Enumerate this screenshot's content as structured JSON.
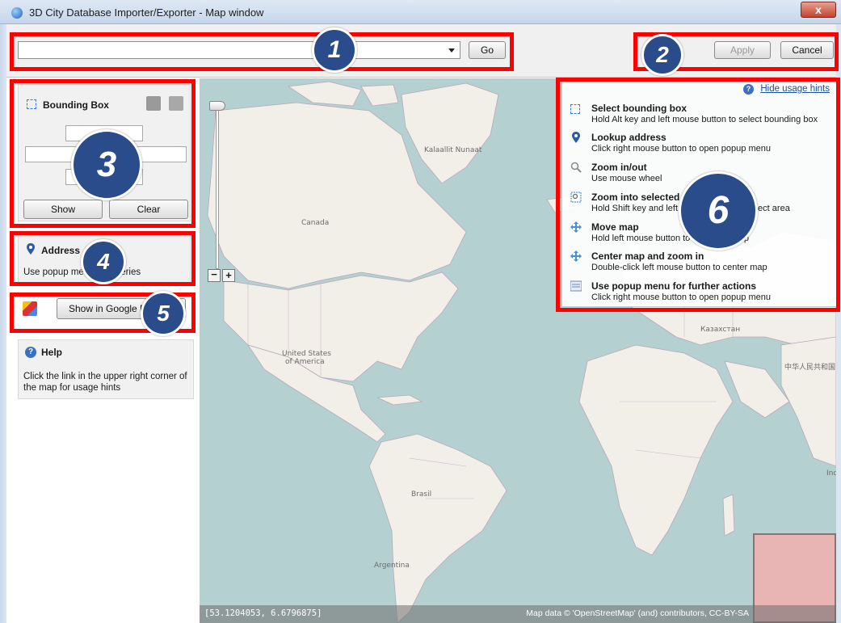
{
  "window": {
    "title": "3D City Database Importer/Exporter - Map window",
    "close_label": "x"
  },
  "toolbar": {
    "search_value": "",
    "go_label": "Go",
    "apply_label": "Apply",
    "cancel_label": "Cancel"
  },
  "left_panel": {
    "bounding_box": {
      "title": "Bounding Box",
      "show_label": "Show",
      "clear_label": "Clear"
    },
    "address": {
      "title": "Address",
      "text": "Use popup menu for queries"
    },
    "google_maps": {
      "button_label": "Show in Google Maps"
    },
    "help": {
      "title": "Help",
      "text": "Click the link in the upper right corner of the map for usage hints"
    }
  },
  "map": {
    "labels": {
      "greenland": "Kalaallit Nunaat",
      "canada": "Canada",
      "usa_1": "United States",
      "usa_2": "of America",
      "brasil": "Brasil",
      "argentina": "Argentina",
      "kazakhstan": "Казахстан",
      "china": "中华人民共和国",
      "india_partial": "Ind"
    },
    "zoom_out": "−",
    "zoom_in": "+",
    "coords_readout": "[53.1204053, 6.6796875]",
    "attribution": "Map data © 'OpenStreetMap' (and) contributors, CC-BY-SA"
  },
  "hints": {
    "hide_link": "Hide usage hints",
    "items": [
      {
        "icon": "bounding-box-icon",
        "title": "Select bounding box",
        "desc": "Hold Alt key and left mouse button to select bounding box"
      },
      {
        "icon": "pin-icon",
        "title": "Lookup address",
        "desc": "Click right mouse button to open popup menu"
      },
      {
        "icon": "magnifier-icon",
        "title": "Zoom in/out",
        "desc": "Use mouse wheel"
      },
      {
        "icon": "zoom-area-icon",
        "title": "Zoom into selected area",
        "desc": "Hold Shift key and left mouse button to select area"
      },
      {
        "icon": "move-icon",
        "title": "Move map",
        "desc": "Hold left mouse button to move the map"
      },
      {
        "icon": "move-icon",
        "title": "Center map and zoom in",
        "desc": "Double-click left mouse button to center map"
      },
      {
        "icon": "menu-icon",
        "title": "Use popup menu for further actions",
        "desc": "Click right mouse button to open popup menu"
      }
    ]
  },
  "callouts": [
    "1",
    "2",
    "3",
    "4",
    "5",
    "6"
  ],
  "colors": {
    "callout_red": "#ff0000",
    "callout_badge": "#2a4c8a",
    "ocean": "#b5d0d0",
    "land": "#f2efe9"
  }
}
